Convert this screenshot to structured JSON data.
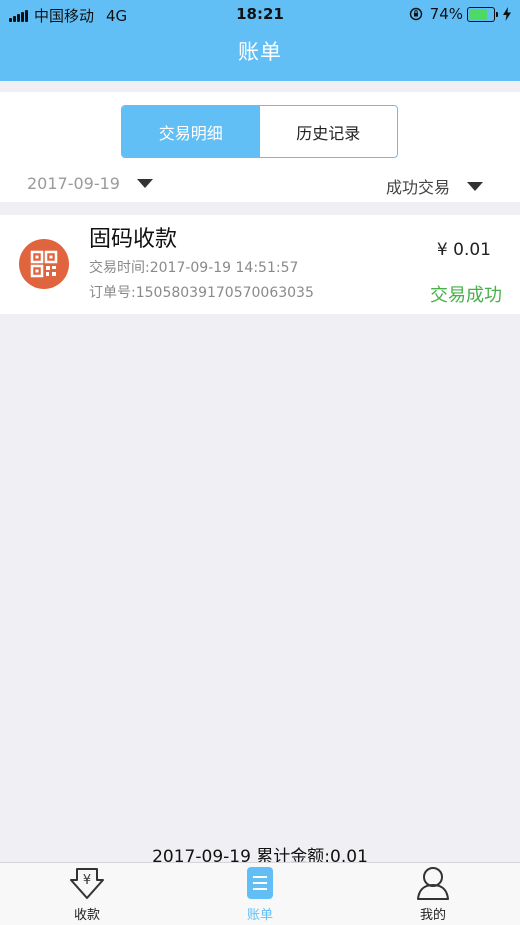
{
  "status_bar": {
    "carrier": "中国移动",
    "network": "4G",
    "time": "18:21",
    "battery_percent": "74%",
    "battery_level": 0.74
  },
  "header": {
    "title": "账单"
  },
  "segments": {
    "active": "交易明细",
    "inactive": "历史记录"
  },
  "filters": {
    "date": "2017-09-19",
    "status": "成功交易"
  },
  "transactions": [
    {
      "title": "固码收款",
      "time": "交易时间:2017-09-19 14:51:57",
      "order": "订单号:15058039170570063035",
      "amount": "¥ 0.01",
      "status": "交易成功"
    }
  ],
  "summary": "2017-09-19 累计金额:0.01",
  "tabbar": {
    "items": [
      {
        "label": "收款",
        "icon": "receive-money-icon"
      },
      {
        "label": "账单",
        "icon": "bill-icon"
      },
      {
        "label": "我的",
        "icon": "profile-icon"
      }
    ],
    "active": "账单"
  },
  "colors": {
    "accent": "#62bff6",
    "success": "#47b049",
    "qr_icon_bg": "#e0643e",
    "background": "#efeff4"
  }
}
